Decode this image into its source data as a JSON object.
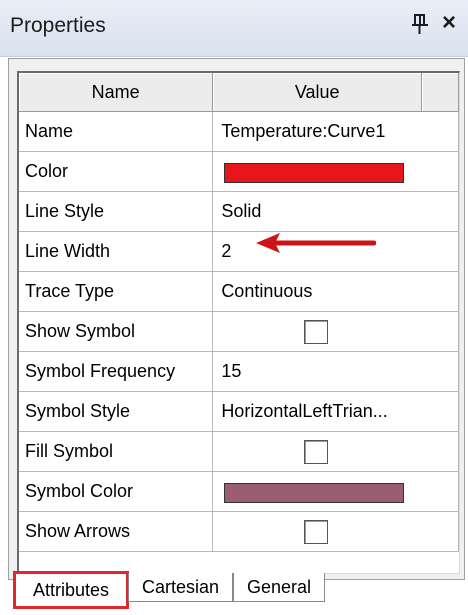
{
  "panel": {
    "title": "Properties"
  },
  "icons": {
    "pin": "pin-icon",
    "close": "close-icon",
    "close_glyph": "×"
  },
  "grid": {
    "headers": {
      "name": "Name",
      "value": "Value"
    },
    "rows": [
      {
        "name": "Name",
        "value": "Temperature:Curve1"
      },
      {
        "name": "Color",
        "value": "",
        "color": "#e8151c"
      },
      {
        "name": "Line Style",
        "value": "Solid"
      },
      {
        "name": "Line Width",
        "value": "2"
      },
      {
        "name": "Trace Type",
        "value": "Continuous"
      },
      {
        "name": "Show Symbol",
        "value": "",
        "checked": false
      },
      {
        "name": "Symbol Frequency",
        "value": "15"
      },
      {
        "name": "Symbol Style",
        "value": "HorizontalLeftTrian..."
      },
      {
        "name": "Fill Symbol",
        "value": "",
        "checked": false
      },
      {
        "name": "Symbol Color",
        "value": "",
        "color": "#9a5d72"
      },
      {
        "name": "Show Arrows",
        "value": "",
        "checked": false
      }
    ]
  },
  "tabs": [
    {
      "label": "Attributes",
      "active": true
    },
    {
      "label": "Cartesian",
      "active": false
    },
    {
      "label": "General",
      "active": false
    }
  ],
  "annotation": {
    "color": "#cc1418",
    "highlight_color": "#e0262e"
  }
}
